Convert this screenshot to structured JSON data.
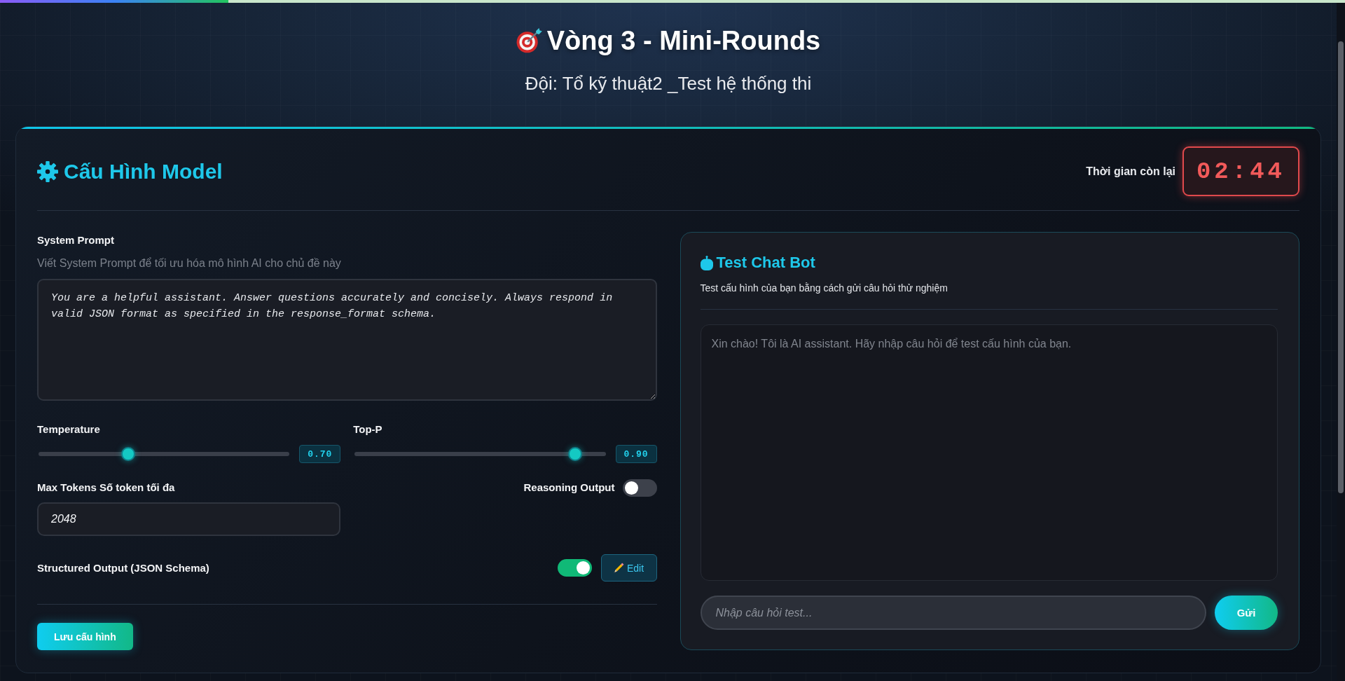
{
  "top_progress": {
    "level": 0.17
  },
  "header": {
    "title": "Vòng 3 - Mini-Rounds",
    "subtitle": "Đội: Tổ kỹ thuật2 _Test hệ thống thi"
  },
  "config": {
    "title": "Cấu Hình Model",
    "timer": {
      "label": "Thời gian còn lại",
      "value": "02:44"
    },
    "system_prompt": {
      "label": "System Prompt",
      "hint": "Viết System Prompt để tối ưu hóa mô hình AI cho chủ đề này",
      "value": "You are a helpful assistant. Answer questions accurately and concisely. Always respond in valid JSON format as specified in the response_format schema."
    },
    "sliders": [
      {
        "label": "Temperature",
        "level": 0.35,
        "reading": "0.70"
      },
      {
        "label": "Top-P",
        "level": 0.9,
        "reading": "0.90"
      }
    ],
    "max_tokens": {
      "label": "Max Tokens Số token tối đa",
      "value": "2048"
    },
    "reasoning_output": {
      "label": "Reasoning Output",
      "on": false
    },
    "structured_output": {
      "label": "Structured Output (JSON Schema)",
      "on": true,
      "edit_button": "Edit"
    },
    "save_button": "Lưu cấu hình"
  },
  "chat": {
    "title": "Test Chat Bot",
    "subtitle": "Test cấu hình của bạn bằng cách gửi câu hỏi thử nghiệm",
    "messages": [
      {
        "text": "Xin chào! Tôi là AI assistant. Hãy nhập câu hỏi để test cấu hình của bạn."
      }
    ],
    "input": {
      "placeholder": "Nhập câu hỏi test..."
    },
    "send_button": "Gửi"
  }
}
